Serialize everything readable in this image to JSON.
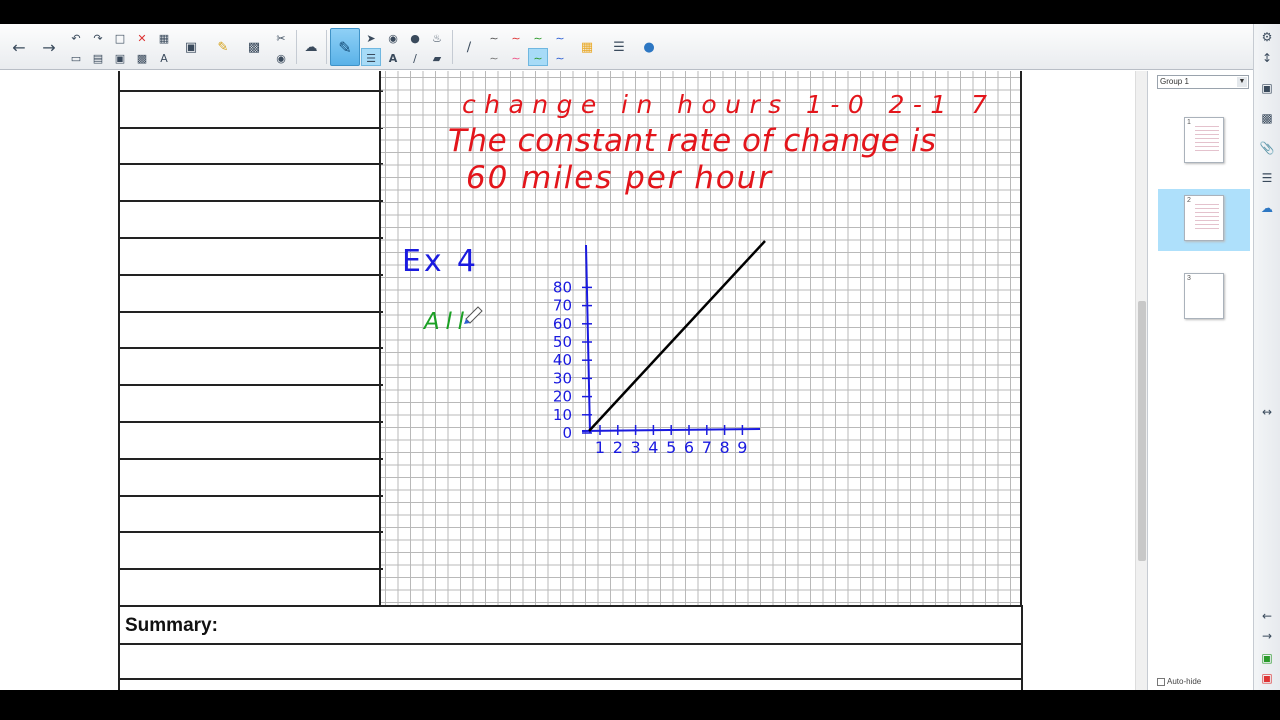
{
  "toolbar": {
    "buttons": [
      "previous-page",
      "next-page",
      "undo",
      "redo",
      "delete",
      "screen-shade",
      "fullscreen",
      "document-camera",
      "insert-table",
      "capture",
      "select",
      "pen",
      "shapes",
      "fill",
      "eraser",
      "line",
      "text",
      "creative-pen",
      "magic-pen"
    ]
  },
  "annotations": {
    "line1": "change in hours   1-0      2-1      7",
    "line2": "The constant rate of change is",
    "line3": "60 miles per hour",
    "example": "Ex 4",
    "green_note": "All"
  },
  "graph": {
    "y_ticks": [
      "0",
      "10",
      "20",
      "30",
      "40",
      "50",
      "60",
      "70",
      "80"
    ],
    "x_ticks": [
      "1",
      "2",
      "3",
      "4",
      "5",
      "6",
      "7",
      "8",
      "9"
    ],
    "colors": {
      "axes": "#1a1adf",
      "line": "#000000",
      "red_ink": "#e3151b",
      "green_ink": "#1aa024"
    }
  },
  "summary": {
    "label": "Summary:"
  },
  "side_panel": {
    "group_label": "Group 1",
    "pages": [
      {
        "num": "1",
        "selected": false
      },
      {
        "num": "2",
        "selected": true
      },
      {
        "num": "3",
        "selected": false
      }
    ],
    "auto_hide_label": "Auto-hide"
  }
}
